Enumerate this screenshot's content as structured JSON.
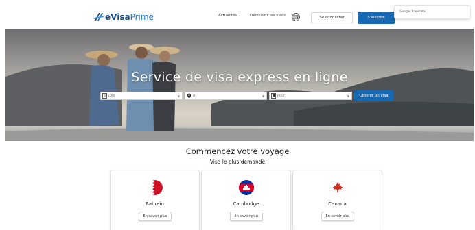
{
  "header": {
    "logo_text_bold": "eVisa",
    "logo_text_light": "Prime",
    "nav_actualites": "Actualités ⌄",
    "nav_decouvrir": "Découvrir les visas",
    "btn_connect": "Se connecter",
    "btn_inscrire": "S'inscrire",
    "translate_label": "Google Translate"
  },
  "hero": {
    "title": "Service de visa express en ligne",
    "fields": {
      "from_placeholder": "Des",
      "to_placeholder": "À",
      "for_placeholder": "Pour"
    },
    "btn_obtenir": "Obtenir un visa"
  },
  "section": {
    "title": "Commencez votre voyage",
    "subtitle": "Visa le plus demandé"
  },
  "cards": [
    {
      "name": "Bahreïn",
      "btn": "En savoir plus",
      "flag_icon": "bahrain-flag-icon"
    },
    {
      "name": "Cambodge",
      "btn": "En savoir plus",
      "flag_icon": "cambodia-flag-icon"
    },
    {
      "name": "Canada",
      "btn": "En savoir plus",
      "flag_icon": "canada-flag-icon"
    }
  ],
  "colors": {
    "primary": "#1769b3",
    "logo_dark": "#1b4f8a"
  }
}
